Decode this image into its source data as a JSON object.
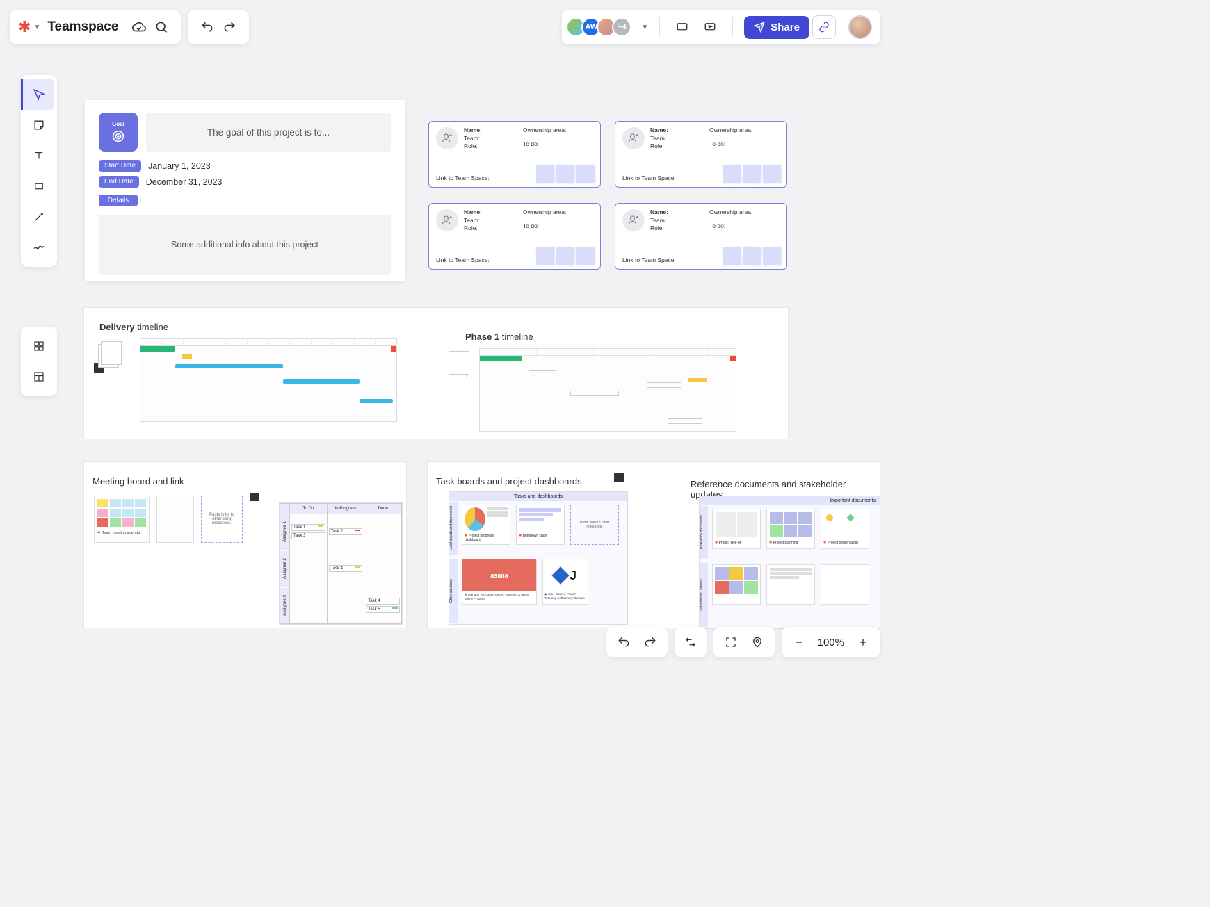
{
  "header": {
    "title": "Teamspace"
  },
  "collaborators": {
    "second_initials": "AW",
    "overflow": "+4"
  },
  "share": {
    "label": "Share"
  },
  "goal": {
    "badge_label": "Goal",
    "text": "The goal of this project is to...",
    "start_chip": "Start Date",
    "start_value": "January 1, 2023",
    "end_chip": "End Date",
    "end_value": "December 31, 2023",
    "details_chip": "Details",
    "details_text": "Some additional info about this project"
  },
  "person": {
    "name_label": "Name:",
    "team_label": "Team:",
    "role_label": "Role:",
    "ownership_label": "Ownership area:",
    "todo_label": "To do:",
    "link_label": "Link to Team Space:"
  },
  "timelines": {
    "delivery_prefix": "Delivery",
    "delivery_suffix": " timeline",
    "phase1_prefix": "Phase 1",
    "phase1_suffix": " timeline"
  },
  "bottom_sections": {
    "meeting": "Meeting board and link",
    "tasks": "Task boards and project dashboards",
    "reference": "Reference documents and stakeholder updates"
  },
  "kanban": {
    "todo": "To Do",
    "inprogress": "In Progress",
    "done": "Done",
    "assignee1": "Assignee 1",
    "assignee2": "Assignee 2",
    "assignee3": "Assignee 3",
    "task1": "Task 1",
    "task2": "Task 2",
    "task3": "Task 3",
    "task4": "Task 4",
    "task5": "Task 5"
  },
  "tasks_panel": {
    "header": "Tasks and dashboards",
    "lucid_label": "Lucid boards and documents",
    "other_label": "Other solutions",
    "dash1": "Project progress dashboard",
    "dash2": "Burndown chart",
    "paste": "Paste links to other resources.",
    "asana": "asana",
    "asana_sub": "Manage your team's work, projects, & tasks online • Asana",
    "jira_sub": "Jira | Issue & Project Tracking Software | Atlassian"
  },
  "reference_panel": {
    "header": "Important documents",
    "side1": "Reference documents",
    "side2": "Stakeholder updates",
    "doc1": "Project kick-off",
    "doc2": "Project planning",
    "doc3": "Project presentation"
  },
  "meeting_panel": {
    "label1": "Team meeting agenda",
    "paste": "Paste links to other daily resources."
  },
  "zoom": {
    "value": "100%"
  }
}
